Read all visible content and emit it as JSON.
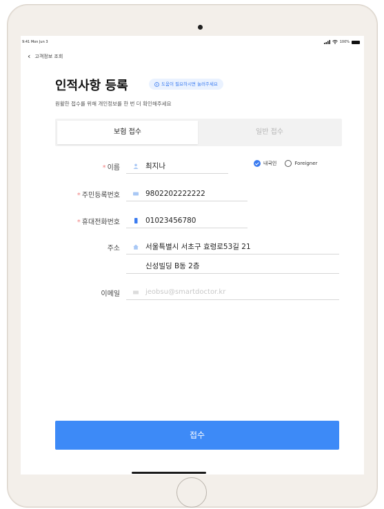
{
  "status_bar": {
    "time": "9:41 Mon Jun 3",
    "battery": "100%"
  },
  "nav": {
    "back_label": "고객정보 조회"
  },
  "header": {
    "title": "인적사항 등록",
    "help_label": "도움이 필요하시면 눌러주세요",
    "subtitle": "원활한 접수를 위해 개인정보를 한 번 더 확인해주세요"
  },
  "tabs": [
    {
      "label": "보험 접수",
      "active": true
    },
    {
      "label": "일반 접수",
      "active": false
    }
  ],
  "form": {
    "name": {
      "label": "이름",
      "required": "*",
      "value": "최지나"
    },
    "nationality": {
      "option1": "내국인",
      "option2": "Foreigner",
      "selected": "내국인"
    },
    "rrn": {
      "label": "주민등록번호",
      "required": "*",
      "value": "9802202222222"
    },
    "phone": {
      "label": "휴대전화번호",
      "required": "*",
      "value": "01023456780"
    },
    "address": {
      "label": "주소",
      "line1": "서울특별시 서초구 효령로53길 21",
      "line2": "신성빌딩 B동 2층"
    },
    "email": {
      "label": "이메일",
      "placeholder": "jeobsu@smartdoctor.kr"
    }
  },
  "submit_label": "접수",
  "colors": {
    "accent": "#3d8af7",
    "required": "#f08080",
    "help_bg": "#eaf2ff"
  }
}
